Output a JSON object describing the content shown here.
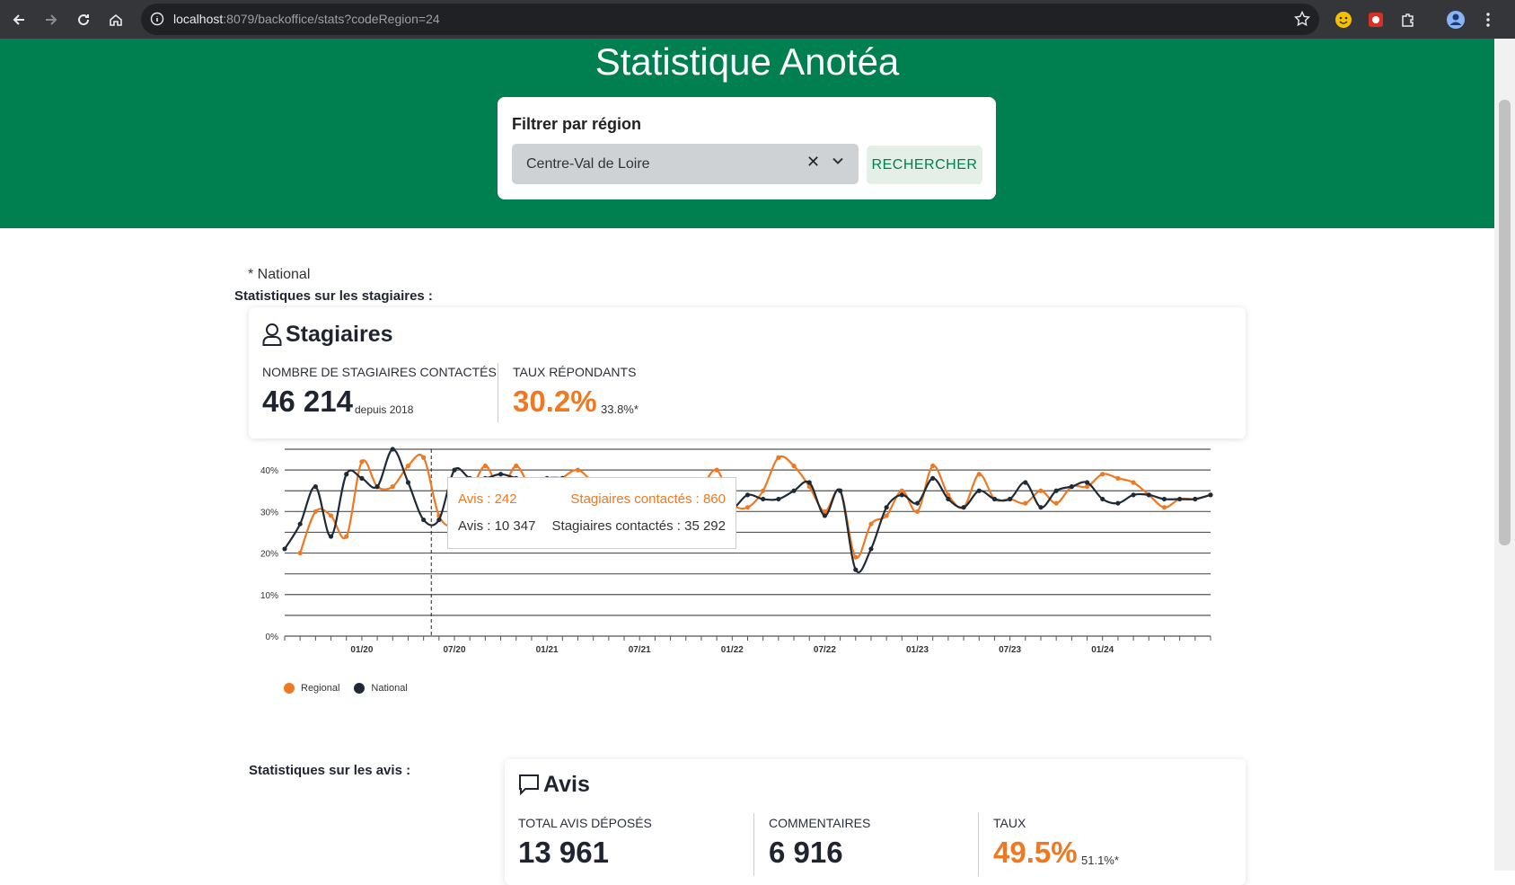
{
  "browser": {
    "url_host": "localhost",
    "url_rest": ":8079/backoffice/stats?codeRegion=24"
  },
  "header": {
    "title": "Statistique Anotéa",
    "filter_label": "Filtrer par région",
    "region_value": "Centre-Val de Loire",
    "clear_glyph": "✕",
    "search_button": "RECHERCHER"
  },
  "stagiaires": {
    "note": "* National",
    "section_title": "Statistiques sur les stagiaires :",
    "card_title": "Stagiaires",
    "contacted_label": "NOMBRE DE STAGIAIRES CONTACTÉS",
    "contacted_value": "46 214",
    "contacted_sub": "depuis 2018",
    "rate_label": "TAUX RÉPONDANTS",
    "rate_value": "30.2%",
    "rate_national": "33.8%*"
  },
  "tooltip": {
    "regional_avis": "Avis : 242",
    "regional_stagiaires": "Stagiaires contactés : 860",
    "national_avis": "Avis : 10 347",
    "national_stagiaires": "Stagiaires contactés : 35 292"
  },
  "avis": {
    "section_title": "Statistiques sur les avis :",
    "card_title": "Avis",
    "total_label": "TOTAL AVIS DÉPOSÉS",
    "total_value": "13 961",
    "comments_label": "COMMENTAIRES",
    "comments_value": "6 916",
    "rate_label": "TAUX",
    "rate_value": "49.5%",
    "rate_national": "51.1%*"
  },
  "colors": {
    "regional": "#f07820",
    "national": "#1f2a38",
    "header_green": "#007f50"
  },
  "chart_data": {
    "type": "line",
    "x_labels": [
      "01/20",
      "07/20",
      "01/21",
      "07/21",
      "01/22",
      "07/22",
      "01/23",
      "07/23",
      "01/24"
    ],
    "y_ticks": [
      "0%",
      "10%",
      "20%",
      "30%",
      "40%"
    ],
    "ylim": [
      0,
      45
    ],
    "legend": [
      "Regional",
      "National"
    ],
    "series": [
      {
        "name": "Regional",
        "values": [
          null,
          20,
          30,
          29,
          24,
          42,
          36,
          36,
          41,
          43,
          29,
          27,
          34,
          41,
          35,
          41,
          35,
          34,
          38,
          40,
          37,
          35,
          35,
          34,
          35,
          35,
          35,
          36,
          40,
          32,
          31,
          35,
          43,
          41,
          36,
          30,
          35,
          19,
          27,
          29,
          35,
          30,
          41,
          34,
          31,
          39,
          33,
          33,
          32,
          35,
          32,
          36,
          36,
          39,
          38,
          37,
          34,
          31,
          33,
          33,
          34
        ]
      },
      {
        "name": "National",
        "values": [
          21,
          27,
          36,
          24,
          39,
          38,
          36,
          45,
          37,
          28,
          28,
          40,
          38,
          38,
          39,
          38,
          37,
          38,
          38,
          37,
          36,
          35,
          36,
          35,
          34,
          34,
          35,
          35,
          35,
          31,
          34,
          33,
          33,
          35,
          37,
          29,
          35,
          16,
          21,
          31,
          34,
          32,
          38,
          33,
          31,
          35,
          33,
          33,
          37,
          31,
          35,
          36,
          37,
          33,
          32,
          34,
          34,
          33,
          33,
          33,
          34
        ]
      }
    ]
  }
}
